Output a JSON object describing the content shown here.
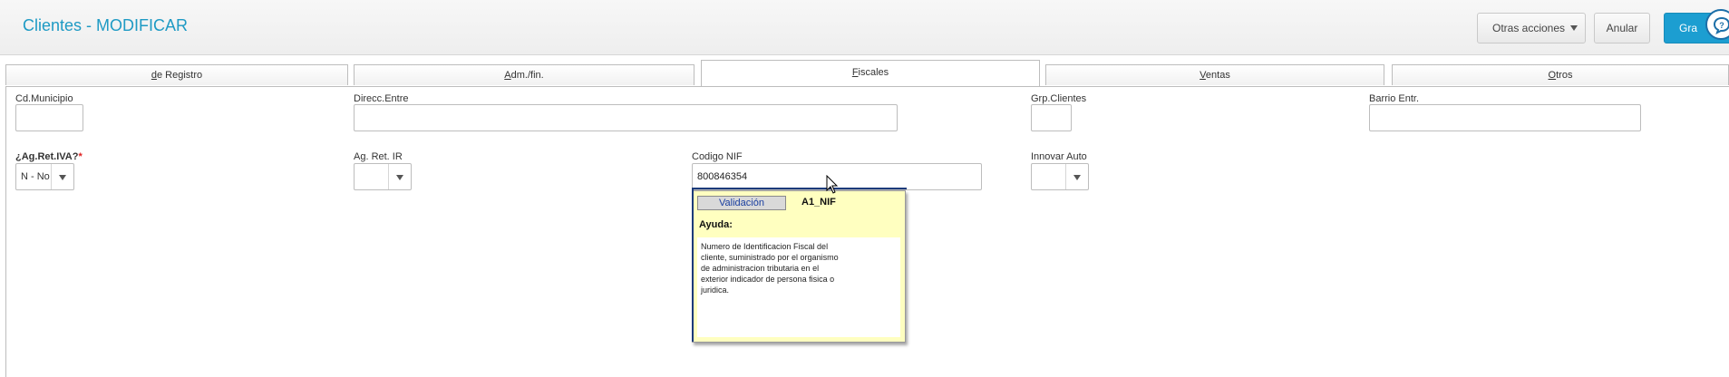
{
  "header": {
    "title": "Clientes - MODIFICAR",
    "otras_acciones": "Otras acciones",
    "anular": "Anular",
    "grabar": "Gra"
  },
  "tabs": [
    {
      "label_u": "d",
      "label_rest": "e Registro"
    },
    {
      "label_u": "A",
      "label_rest": "dm./fin."
    },
    {
      "label_u": "F",
      "label_rest": "iscales"
    },
    {
      "label_u": "V",
      "label_rest": "entas"
    },
    {
      "label_u": "O",
      "label_rest": "tros"
    }
  ],
  "fields": {
    "cd_municipio": {
      "label": "Cd.Municipio",
      "value": ""
    },
    "direcc_entre": {
      "label": "Direcc.Entre",
      "value": ""
    },
    "grp_clientes": {
      "label": "Grp.Clientes",
      "value": ""
    },
    "barrio_entr": {
      "label": "Barrio Entr.",
      "value": ""
    },
    "ag_ret_iva": {
      "label": "¿Ag.Ret.IVA?",
      "required_mark": "*",
      "value": "N - No"
    },
    "ag_ret_ir": {
      "label": "Ag. Ret. IR",
      "value": ""
    },
    "codigo_nif": {
      "label": "Codigo NIF",
      "value": "800846354"
    },
    "innovar_auto": {
      "label": "Innovar Auto",
      "value": ""
    }
  },
  "tooltip": {
    "tab": "Validación",
    "field_code": "A1_NIF",
    "heading": "Ayuda:",
    "line1": "Numero de Identificacion Fiscal del",
    "line2": "cliente, suministrado por el organismo",
    "line3": "de administracion tributaria en el",
    "line4": "exterior indicador de persona fisica o",
    "line5": "juridica."
  },
  "colors": {
    "accent": "#1e9ac4",
    "primary_button": "#1c9ed1",
    "tooltip_bg": "#ffffc0",
    "required": "#e02020"
  }
}
